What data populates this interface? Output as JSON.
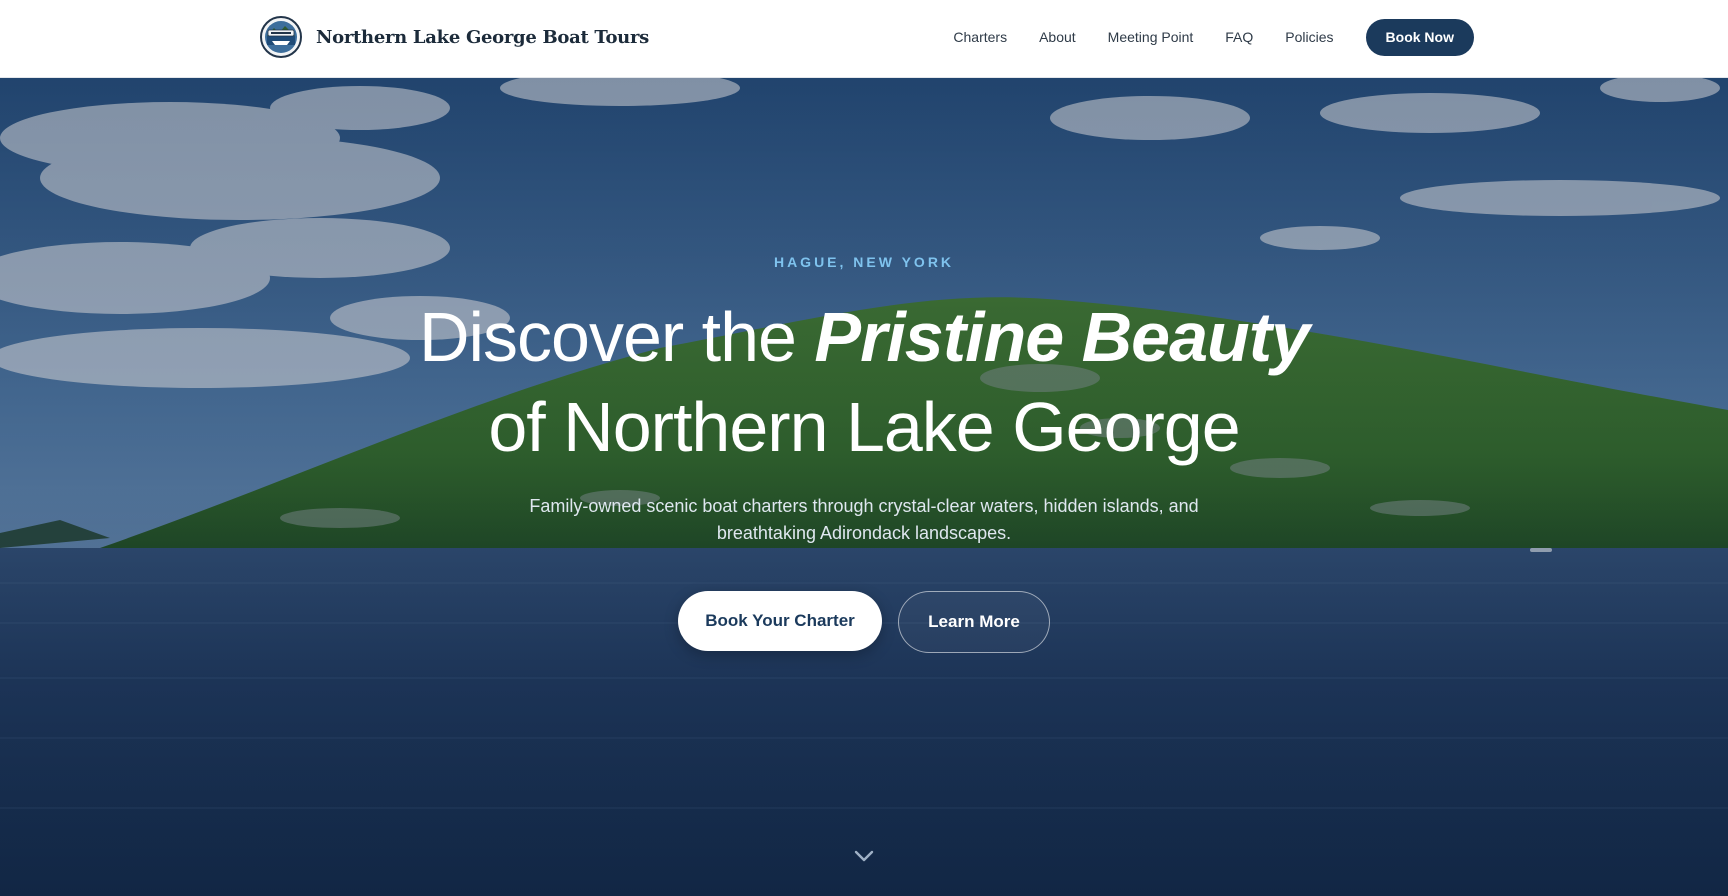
{
  "brand": {
    "name": "Northern Lake George Boat Tours",
    "logo_icon": "boat-tours-badge-icon"
  },
  "nav": {
    "links": [
      "Charters",
      "About",
      "Meeting Point",
      "FAQ",
      "Policies"
    ],
    "cta_label": "Book Now"
  },
  "hero": {
    "eyebrow": "HAGUE, NEW YORK",
    "headline_part1": "Discover the ",
    "headline_emphasis": "Pristine Beauty",
    "headline_part2": "of Northern Lake George",
    "subtitle": "Family-owned scenic boat charters through crystal-clear waters, hidden islands, and breathtaking Adirondack landscapes.",
    "primary_button": "Book Your Charter",
    "secondary_button": "Learn More",
    "scroll_icon": "chevron-down-icon"
  },
  "colors": {
    "brand_navy": "#1b3a5c",
    "eyebrow_blue": "#7fc3ee",
    "header_bg": "#ffffff"
  }
}
